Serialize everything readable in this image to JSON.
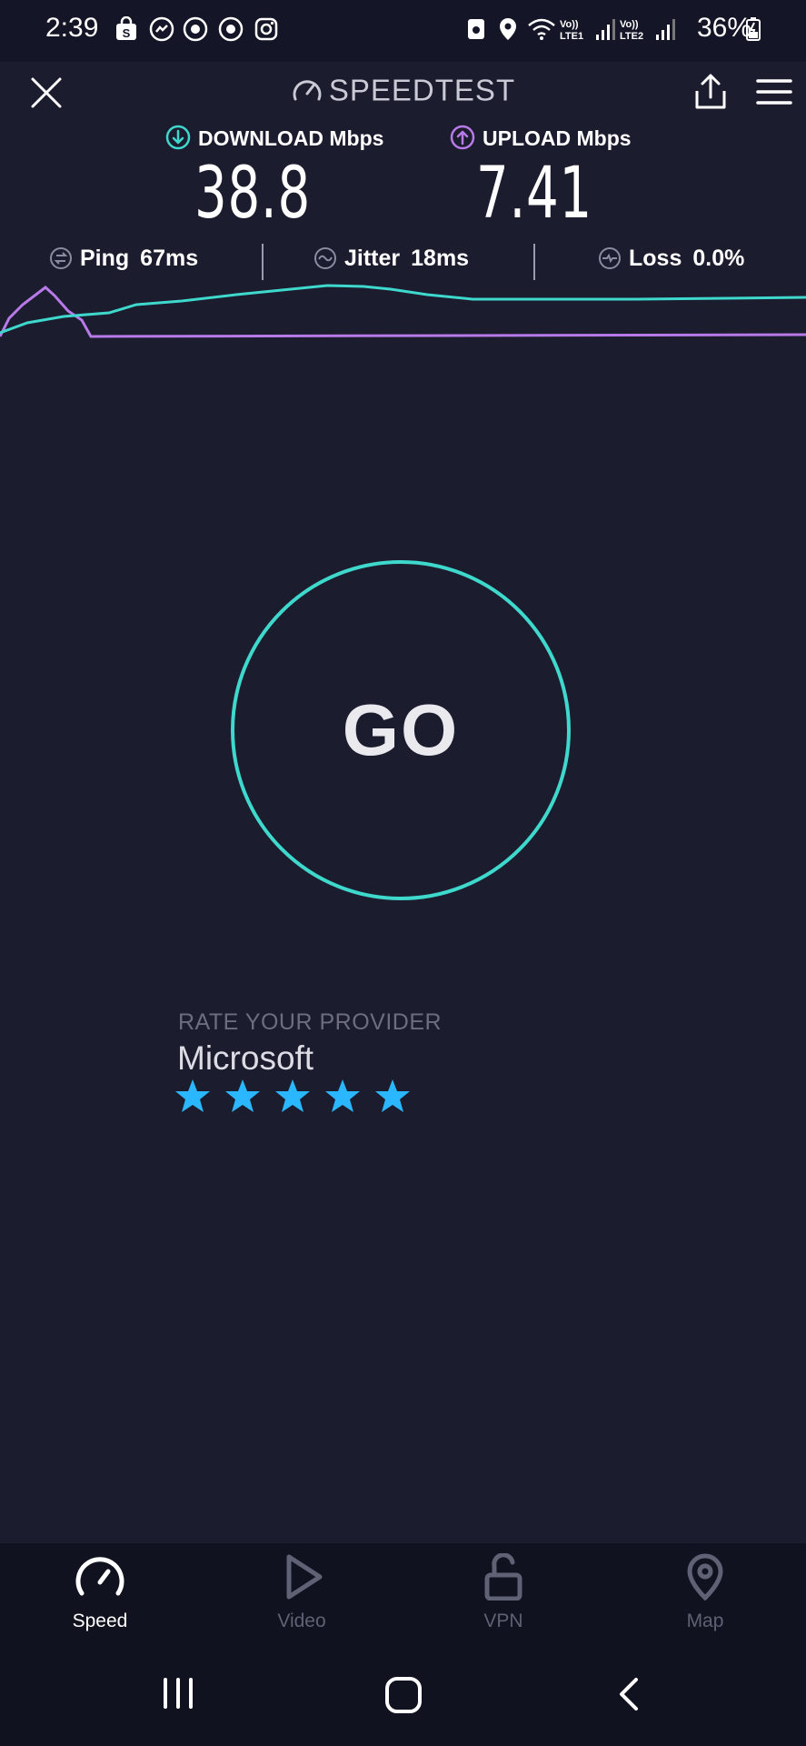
{
  "status_bar": {
    "time": "2:39",
    "battery_percent": "36%",
    "signal_labels": [
      "Vo)) LTE1",
      "Vo)) LTE2"
    ]
  },
  "header": {
    "title": "SPEEDTEST",
    "close_icon": "close-icon",
    "share_icon": "share-icon",
    "menu_icon": "hamburger-menu-icon"
  },
  "metrics": {
    "download_label": "DOWNLOAD Mbps",
    "download_value": "38.8",
    "upload_label": "UPLOAD Mbps",
    "upload_value": "7.41"
  },
  "stats": {
    "ping_label": "Ping",
    "ping_value": "67ms",
    "jitter_label": "Jitter",
    "jitter_value": "18ms",
    "loss_label": "Loss",
    "loss_value": "0.0%"
  },
  "go_label": "GO",
  "rate": {
    "title": "RATE YOUR PROVIDER",
    "provider": "Microsoft",
    "stars": 5
  },
  "bottom_nav": {
    "items": [
      {
        "label": "Speed",
        "icon": "speedometer-icon",
        "active": true
      },
      {
        "label": "Video",
        "icon": "play-icon",
        "active": false
      },
      {
        "label": "VPN",
        "icon": "unlock-icon",
        "active": false
      },
      {
        "label": "Map",
        "icon": "map-pin-icon",
        "active": false
      }
    ]
  },
  "colors": {
    "background": "#1b1c2e",
    "download_accent": "#3ed8cc",
    "upload_accent": "#b77ae8",
    "star": "#2bb7ff"
  }
}
